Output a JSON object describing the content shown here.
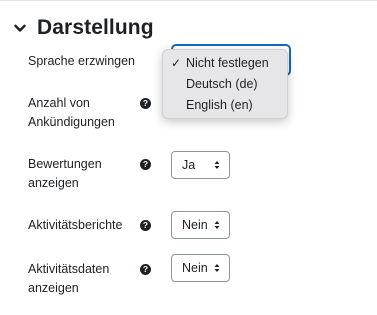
{
  "section": {
    "title": "Darstellung",
    "collapse_icon": "chevron-down-icon"
  },
  "fields": {
    "force_language": {
      "label": "Sprache erzwingen",
      "dropdown_options": [
        "Nicht festlegen",
        "Deutsch (de)",
        "English (en)"
      ],
      "selected_option": "Nicht festlegen",
      "checkmark": "✓"
    },
    "news_items": {
      "label_line1": "Anzahl von",
      "label_line2": "Ankündigungen",
      "help_icon": "question-circle-icon",
      "help_glyph": "?"
    },
    "show_grades": {
      "label_line1": "Bewertungen",
      "label_line2": "anzeigen",
      "help_glyph": "?",
      "value": "Ja"
    },
    "activity_reports": {
      "label": "Aktivitätsberichte",
      "help_glyph": "?",
      "value": "Nein"
    },
    "activity_dates": {
      "label_line1": "Aktivitätsdaten",
      "label_line2": "anzeigen",
      "help_glyph": "?",
      "value": "Nein"
    }
  },
  "colors": {
    "text": "#1d2125",
    "focus_border": "#0f6cbf",
    "select_border": "#8f959e",
    "dropdown_bg": "#e6e6e8"
  }
}
